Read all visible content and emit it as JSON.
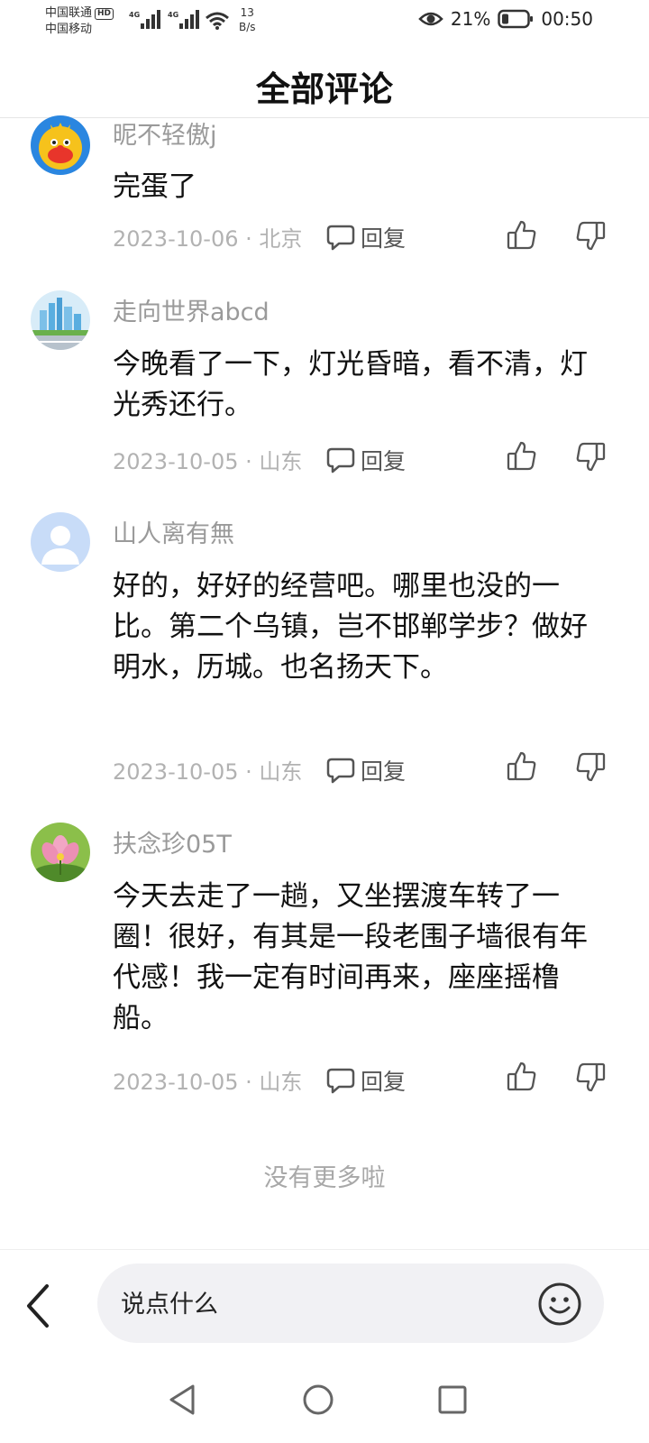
{
  "status_bar": {
    "carrier_1": "中国联通",
    "carrier_1_badge": "HD",
    "carrier_2": "中国移动",
    "network_1": "4G",
    "network_2": "4G",
    "speed_value": "13",
    "speed_unit": "B/s",
    "battery": "21%",
    "time": "00:50"
  },
  "header": {
    "title": "全部评论"
  },
  "comments": [
    {
      "username": "昵不轻傲j",
      "content": "完蛋了",
      "meta": "2023-10-06 · 北京",
      "reply_label": "回复",
      "avatar": "cartoon-character"
    },
    {
      "username": "走向世界abcd",
      "content": "今晚看了一下，灯光昏暗，看不清，灯光秀还行。",
      "meta": "2023-10-05 · 山东",
      "reply_label": "回复",
      "avatar": "city-skyline"
    },
    {
      "username": "山人离有無",
      "content": "好的，好好的经营吧。哪里也没的一比。第二个乌镇，岂不邯郸学步？做好明水，历城。也名扬天下。",
      "meta": "2023-10-05 · 山东",
      "reply_label": "回复",
      "avatar": "default-user"
    },
    {
      "username": "扶念珍05T",
      "content": "今天去走了一趟，又坐摆渡车转了一圈！很好，有其是一段老围子墙很有年代感！我一定有时间再来，座座摇橹船。",
      "meta": "2023-10-05 · 山东",
      "reply_label": "回复",
      "avatar": "lotus-flower"
    }
  ],
  "no_more_text": "没有更多啦",
  "input_bar": {
    "placeholder": "说点什么"
  },
  "icons": {
    "back": "chevron-left-icon",
    "emoji": "smiley-icon",
    "reply": "comment-bubble-icon",
    "like": "thumbs-up-icon",
    "dislike": "thumbs-down-icon",
    "nav_back": "triangle-back-icon",
    "nav_home": "circle-home-icon",
    "nav_recents": "square-recents-icon"
  },
  "colors": {
    "text_primary": "#111111",
    "text_secondary": "#9a9a9a",
    "meta": "#b2b2b2",
    "input_bg": "#f1f1f4"
  }
}
